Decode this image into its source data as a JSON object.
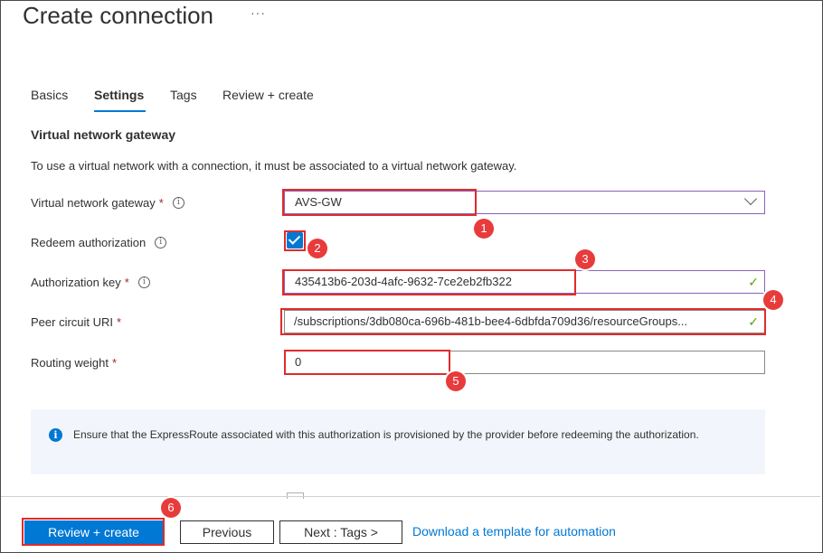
{
  "page": {
    "title": "Create connection",
    "more_label": "···"
  },
  "tabs": [
    {
      "label": "Basics",
      "active": false
    },
    {
      "label": "Settings",
      "active": true
    },
    {
      "label": "Tags",
      "active": false
    },
    {
      "label": "Review + create",
      "active": false
    }
  ],
  "section": {
    "title": "Virtual network gateway",
    "description": "To use a virtual network with a connection, it must be associated to a virtual network gateway."
  },
  "fields": {
    "gateway": {
      "label": "Virtual network gateway",
      "required_mark": "*",
      "value": "AVS-GW",
      "icon": "chevron-down-icon"
    },
    "redeem": {
      "label": "Redeem authorization",
      "checked": true
    },
    "auth_key": {
      "label": "Authorization key",
      "required_mark": "*",
      "value": "435413b6-203d-4afc-9632-7ce2eb2fb322",
      "valid": true
    },
    "peer_uri": {
      "label": "Peer circuit URI",
      "required_mark": "*",
      "value": "/subscriptions/3db080ca-696b-481b-bee4-6dbfda709d36/resourceGroups...",
      "valid": true
    },
    "routing_weight": {
      "label": "Routing weight",
      "required_mark": "*",
      "value": "0"
    }
  },
  "info_box": {
    "icon": "info-icon",
    "text": "Ensure that the ExpressRoute associated with this authorization is provisioned by the provider before redeeming the authorization."
  },
  "annotations": [
    "1",
    "2",
    "3",
    "4",
    "5",
    "6"
  ],
  "footer": {
    "review_create": "Review + create",
    "previous": "Previous",
    "next": "Next : Tags >",
    "download_link": "Download a template for automation"
  },
  "colors": {
    "accent": "#0078d4",
    "required": "#a4262c",
    "valid": "#57a300",
    "annotation": "#e02b2b"
  }
}
